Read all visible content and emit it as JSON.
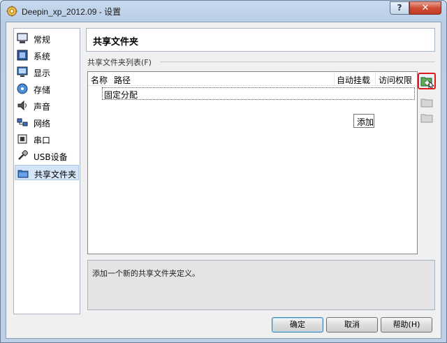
{
  "window": {
    "title": "Deepin_xp_2012.09 - 设置",
    "help_label": "?",
    "close_label": "✕"
  },
  "sidebar": {
    "items": [
      {
        "label": "常规",
        "icon": "monitor-general-icon"
      },
      {
        "label": "系统",
        "icon": "chip-system-icon"
      },
      {
        "label": "显示",
        "icon": "display-icon"
      },
      {
        "label": "存储",
        "icon": "disk-storage-icon"
      },
      {
        "label": "声音",
        "icon": "speaker-icon"
      },
      {
        "label": "网络",
        "icon": "network-icon"
      },
      {
        "label": "串口",
        "icon": "serial-port-icon"
      },
      {
        "label": "USB设备",
        "icon": "usb-icon"
      },
      {
        "label": "共享文件夹",
        "icon": "folder-icon",
        "selected": true
      }
    ]
  },
  "page": {
    "title": "共享文件夹",
    "group_label": "共享文件夹列表(F)",
    "columns": {
      "name": "名称",
      "path": "路径",
      "automount": "自动挂载",
      "access": "访问权限"
    },
    "rows": [
      {
        "label": "固定分配"
      }
    ],
    "tooltip": "添加",
    "description": "添加一个新的共享文件夹定义。"
  },
  "buttons": {
    "ok": "确定",
    "cancel": "取消",
    "help": "帮助(H)"
  },
  "colors": {
    "highlight": "#e21a1a",
    "selection": "#d5e5f8"
  }
}
